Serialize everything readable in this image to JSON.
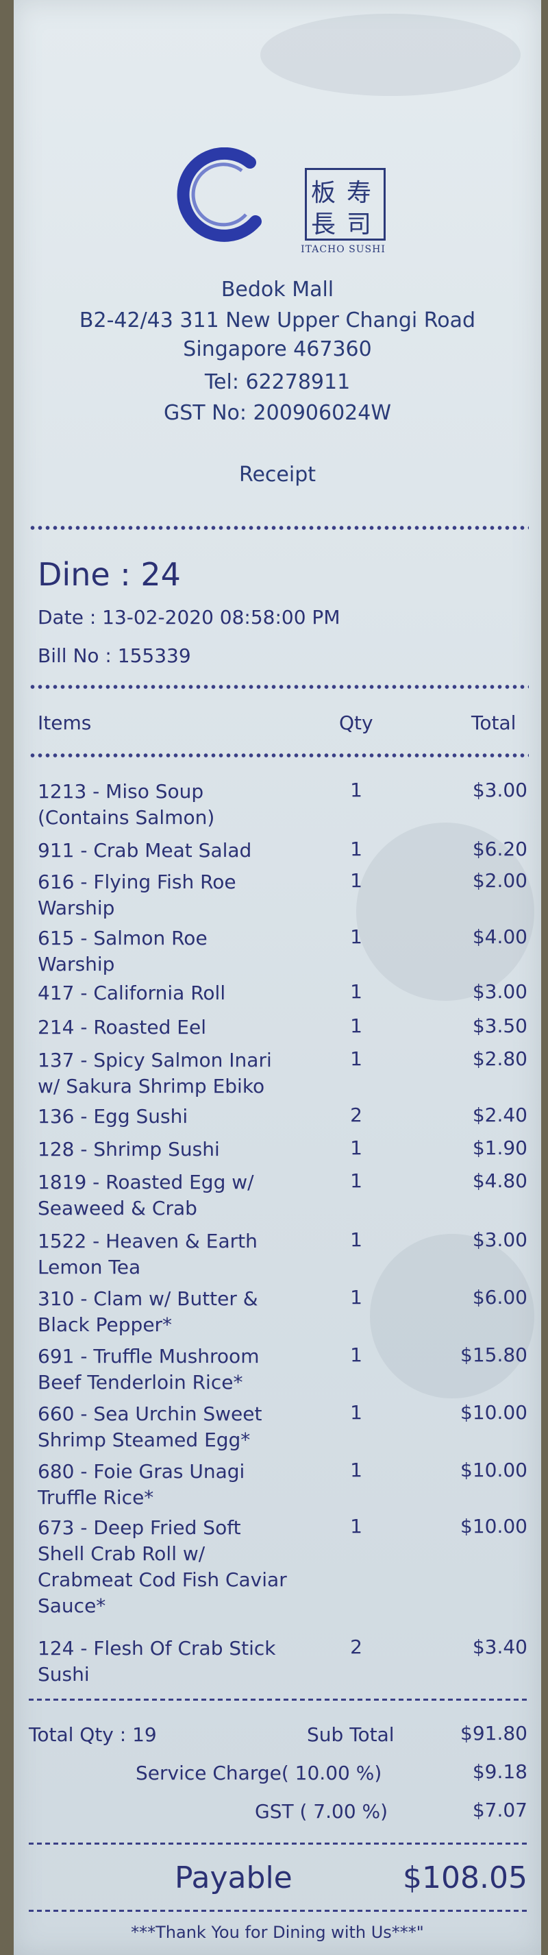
{
  "store": {
    "brand_en": "ITACHO SUSHI",
    "brand_jp": [
      "板",
      "寿",
      "長",
      "司"
    ],
    "mall": "Bedok Mall",
    "address": "B2-42/43 311 New Upper Changi Road",
    "city": "Singapore 467360",
    "tel": "Tel: 62278911",
    "gst_no": "GST No: 200906024W"
  },
  "doc_title": "Receipt",
  "order": {
    "dine": "Dine : 24",
    "date": "Date : 13-02-2020 08:58:00 PM",
    "bill_no": "Bill No : 155339"
  },
  "columns": {
    "items": "Items",
    "qty": "Qty",
    "total": "Total"
  },
  "items": [
    {
      "lines": [
        "1213 - Miso Soup",
        "(Contains Salmon)"
      ],
      "qty": "1",
      "total": "$3.00"
    },
    {
      "lines": [
        "911 - Crab Meat Salad"
      ],
      "qty": "1",
      "total": "$6.20"
    },
    {
      "lines": [
        "616 - Flying Fish Roe",
        "Warship"
      ],
      "qty": "1",
      "total": "$2.00"
    },
    {
      "lines": [
        "615 - Salmon Roe",
        "Warship"
      ],
      "qty": "1",
      "total": "$4.00"
    },
    {
      "lines": [
        "417 - California Roll"
      ],
      "qty": "1",
      "total": "$3.00"
    },
    {
      "lines": [
        "214 - Roasted Eel"
      ],
      "qty": "1",
      "total": "$3.50"
    },
    {
      "lines": [
        "137 - Spicy Salmon Inari",
        "w/ Sakura Shrimp Ebiko"
      ],
      "qty": "1",
      "total": "$2.80"
    },
    {
      "lines": [
        "136 - Egg Sushi"
      ],
      "qty": "2",
      "total": "$2.40"
    },
    {
      "lines": [
        "128 - Shrimp Sushi"
      ],
      "qty": "1",
      "total": "$1.90"
    },
    {
      "lines": [
        "1819 - Roasted Egg w/",
        "Seaweed & Crab"
      ],
      "qty": "1",
      "total": "$4.80"
    },
    {
      "lines": [
        "1522 - Heaven & Earth",
        "Lemon Tea"
      ],
      "qty": "1",
      "total": "$3.00"
    },
    {
      "lines": [
        "310 - Clam w/ Butter &",
        "Black Pepper*"
      ],
      "qty": "1",
      "total": "$6.00"
    },
    {
      "lines": [
        "691 - Truffle Mushroom",
        "Beef Tenderloin Rice*"
      ],
      "qty": "1",
      "total": "$15.80"
    },
    {
      "lines": [
        "660 - Sea Urchin Sweet",
        "Shrimp Steamed Egg*"
      ],
      "qty": "1",
      "total": "$10.00"
    },
    {
      "lines": [
        "680 - Foie Gras Unagi",
        "Truffle Rice*"
      ],
      "qty": "1",
      "total": "$10.00"
    },
    {
      "lines": [
        "673 - Deep Fried Soft",
        "Shell Crab Roll w/",
        "Crabmeat Cod Fish Caviar",
        "Sauce*"
      ],
      "qty": "1",
      "total": "$10.00"
    },
    {
      "lines": [
        "124 - Flesh Of Crab Stick",
        "Sushi"
      ],
      "qty": "2",
      "total": "$3.40"
    }
  ],
  "summary": {
    "total_qty": "Total Qty : 19",
    "subtotal_label": "Sub Total",
    "subtotal": "$91.80",
    "service_label": "Service Charge( 10.00 %)",
    "service": "$9.18",
    "gst_label": "GST ( 7.00 %)",
    "gst": "$7.07"
  },
  "payable": {
    "label": "Payable",
    "amount": "$108.05"
  },
  "footer": "***Thank You for Dining with Us***\""
}
